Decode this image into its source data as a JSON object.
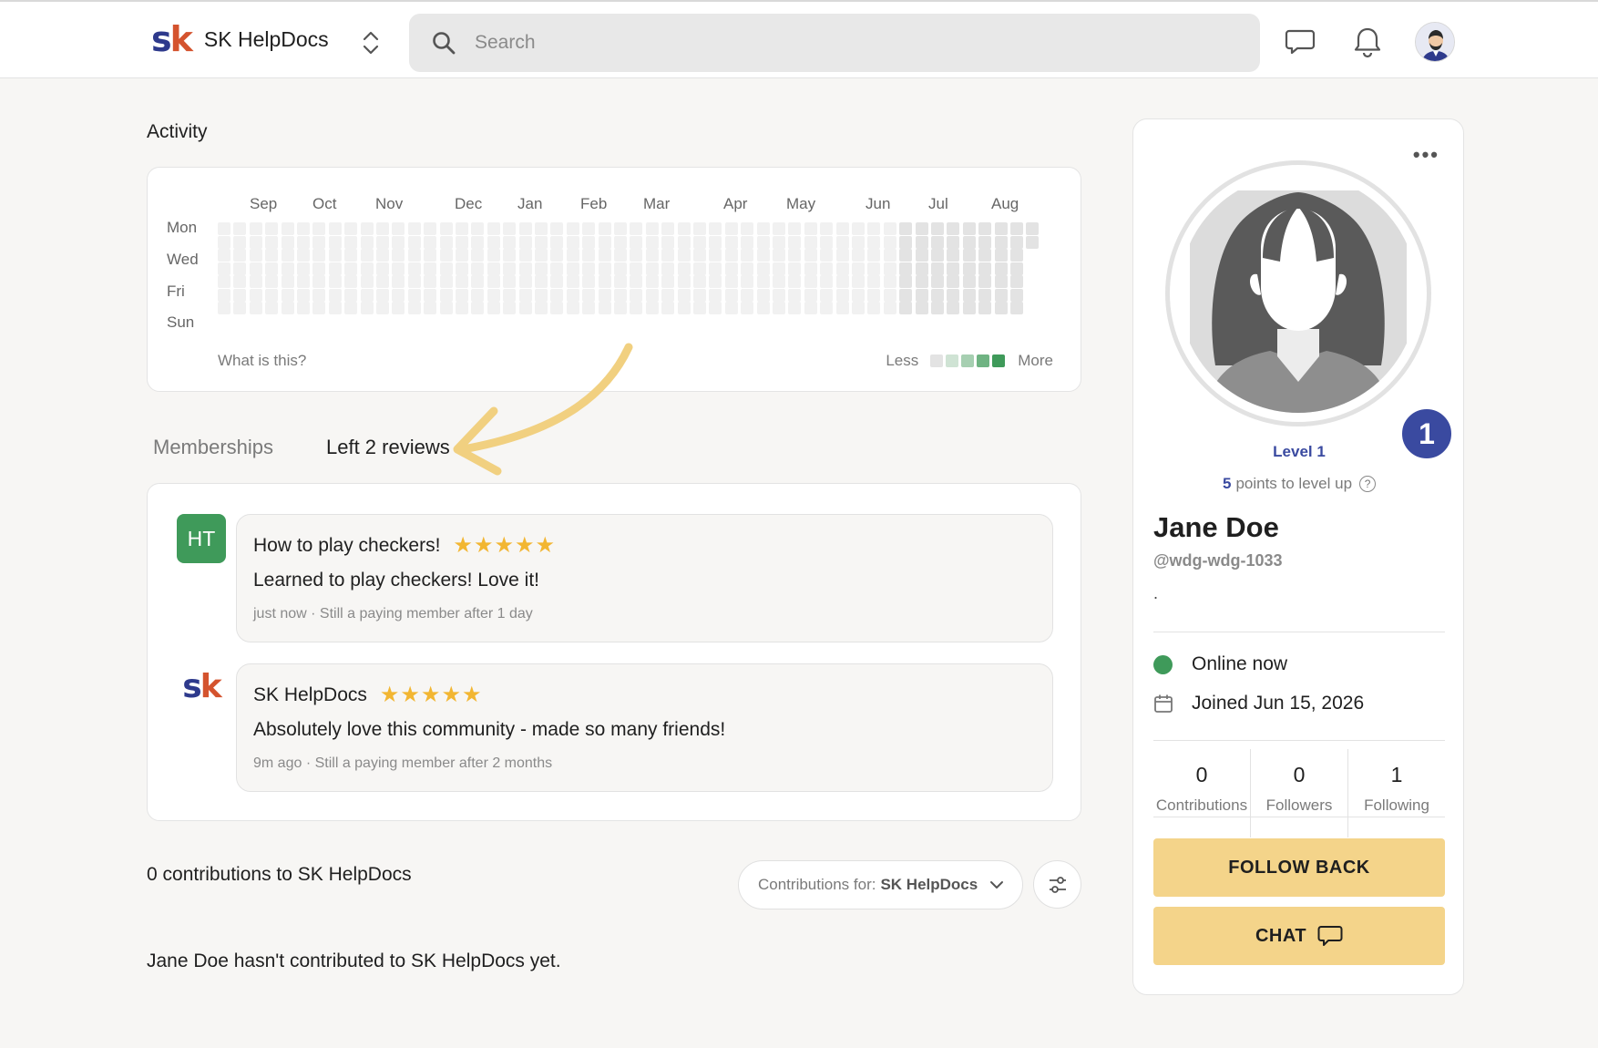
{
  "header": {
    "brand_name": "SK HelpDocs",
    "logo_s": "s",
    "logo_k": "k",
    "search_placeholder": "Search"
  },
  "activity": {
    "title": "Activity",
    "months": [
      "Sep",
      "Oct",
      "Nov",
      "Dec",
      "Jan",
      "Feb",
      "Mar",
      "Apr",
      "May",
      "Jun",
      "Jul",
      "Aug"
    ],
    "days": [
      "Mon",
      "Wed",
      "Fri",
      "Sun"
    ],
    "what_link": "What is this?",
    "legend_less": "Less",
    "legend_more": "More",
    "legend_colors": [
      "#e3e3e3",
      "#cfe3d4",
      "#a6cfb1",
      "#6fb382",
      "#3f9a5a"
    ]
  },
  "tabs": {
    "memberships": "Memberships",
    "reviews": "Left 2 reviews"
  },
  "reviews": [
    {
      "avatar_text": "HT",
      "avatar_color": "#3f9a5a",
      "title": "How to play checkers!",
      "rating": 5,
      "text": "Learned to play checkers! Love it!",
      "meta": "just now · Still a paying member after 1 day"
    },
    {
      "avatar_text": "sk",
      "title": "SK HelpDocs",
      "rating": 5,
      "text": "Absolutely love this community - made so many friends!",
      "meta": "9m ago · Still a paying member after 2 months"
    }
  ],
  "contributions": {
    "title": "0 contributions to SK HelpDocs",
    "select_label": "Contributions for:",
    "select_value": "SK HelpDocs",
    "empty_text": "Jane Doe hasn't contributed to SK HelpDocs yet."
  },
  "profile": {
    "menu_dots": "•••",
    "level_number": "1",
    "level_label": "Level 1",
    "points_number": "5",
    "points_text": "points to level up",
    "help_glyph": "?",
    "name": "Jane Doe",
    "handle": "@wdg-wdg-1033",
    "bio": ".",
    "status": "Online now",
    "joined": "Joined Jun 15, 2026",
    "stats": [
      {
        "value": "0",
        "label": "Contributions"
      },
      {
        "value": "0",
        "label": "Followers"
      },
      {
        "value": "1",
        "label": "Following"
      }
    ],
    "follow_button": "FOLLOW BACK",
    "chat_button": "CHAT"
  },
  "colors": {
    "accent": "#3a4aa0",
    "button": "#f4d48a",
    "online": "#3f9a5a",
    "star": "#f2b632",
    "logo_s": "#2e3a8c",
    "logo_k": "#d4532e"
  }
}
